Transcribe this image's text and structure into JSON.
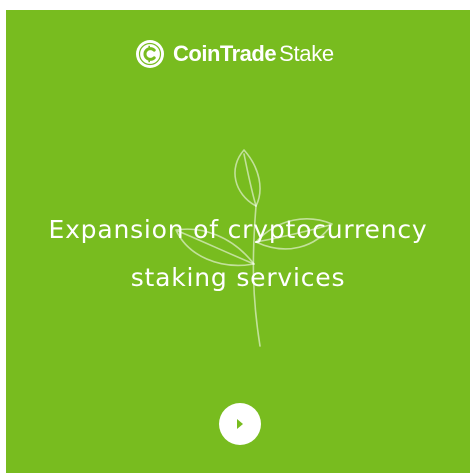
{
  "brand": {
    "name_bold": "CoinTrade",
    "name_light": "Stake",
    "logo_icon": "coin-c-logo-icon"
  },
  "hero": {
    "headline_line1": "Expansion of cryptocurrency",
    "headline_line2": "staking services",
    "decoration_icon": "sprout-outline-icon"
  },
  "controls": {
    "next_icon": "chevron-right-icon"
  },
  "colors": {
    "background": "#78bc1f",
    "text": "#ffffff",
    "accent": "#78bc1f"
  }
}
